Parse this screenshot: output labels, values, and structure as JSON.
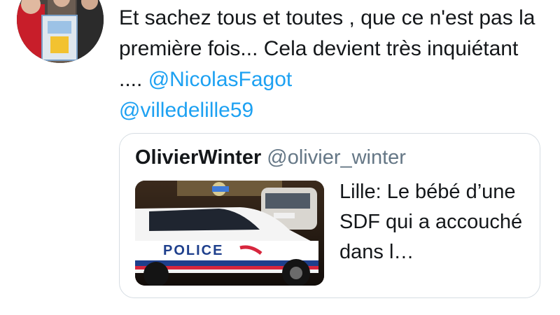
{
  "tweet": {
    "text_prefix": "Et sachez tous et toutes , que ce n'est pas la première fois... Cela devient très inquiétant .... ",
    "mention_1": "@NicolasFagot",
    "mention_2": "@villedelille59"
  },
  "quoted_tweet": {
    "display_name": "OlivierWinter",
    "handle": "@olivier_winter",
    "text": "Lille: Le bébé d’une SDF qui a accouché dans l…",
    "media": {
      "icon": "police-car-photo",
      "car_label": "POLICE"
    }
  },
  "colors": {
    "link": "#1da1f2",
    "handle": "#657786",
    "border": "#d6dde3"
  }
}
